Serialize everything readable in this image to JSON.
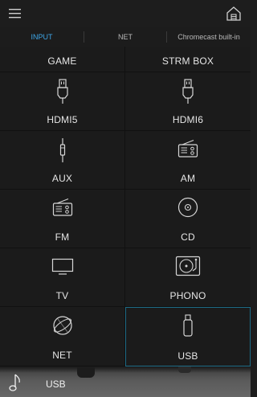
{
  "header": {
    "menu_icon": "hamburger-menu-icon",
    "home_icon": "home-icon"
  },
  "tabs": [
    {
      "label": "INPUT",
      "active": true
    },
    {
      "label": "NET",
      "active": false
    },
    {
      "label": "Chromecast built-in",
      "active": false
    }
  ],
  "inputs": [
    {
      "label": "GAME",
      "icon": ""
    },
    {
      "label": "STRM BOX",
      "icon": ""
    },
    {
      "label": "HDMI5",
      "icon": "hdmi-plug-icon"
    },
    {
      "label": "HDMI6",
      "icon": "hdmi-plug-icon"
    },
    {
      "label": "AUX",
      "icon": "aux-jack-icon"
    },
    {
      "label": "AM",
      "icon": "radio-icon"
    },
    {
      "label": "FM",
      "icon": "radio-icon"
    },
    {
      "label": "CD",
      "icon": "cd-disc-icon"
    },
    {
      "label": "TV",
      "icon": "tv-icon"
    },
    {
      "label": "PHONO",
      "icon": "turntable-icon"
    },
    {
      "label": "NET",
      "icon": "globe-icon"
    },
    {
      "label": "USB",
      "icon": "usb-stick-icon",
      "selected": true
    }
  ],
  "now_playing": {
    "source": "USB",
    "icon": "music-note-icon"
  },
  "colors": {
    "accent": "#3ea7e8",
    "background": "#1d1d1d",
    "selected_border": "#1d6b86"
  }
}
